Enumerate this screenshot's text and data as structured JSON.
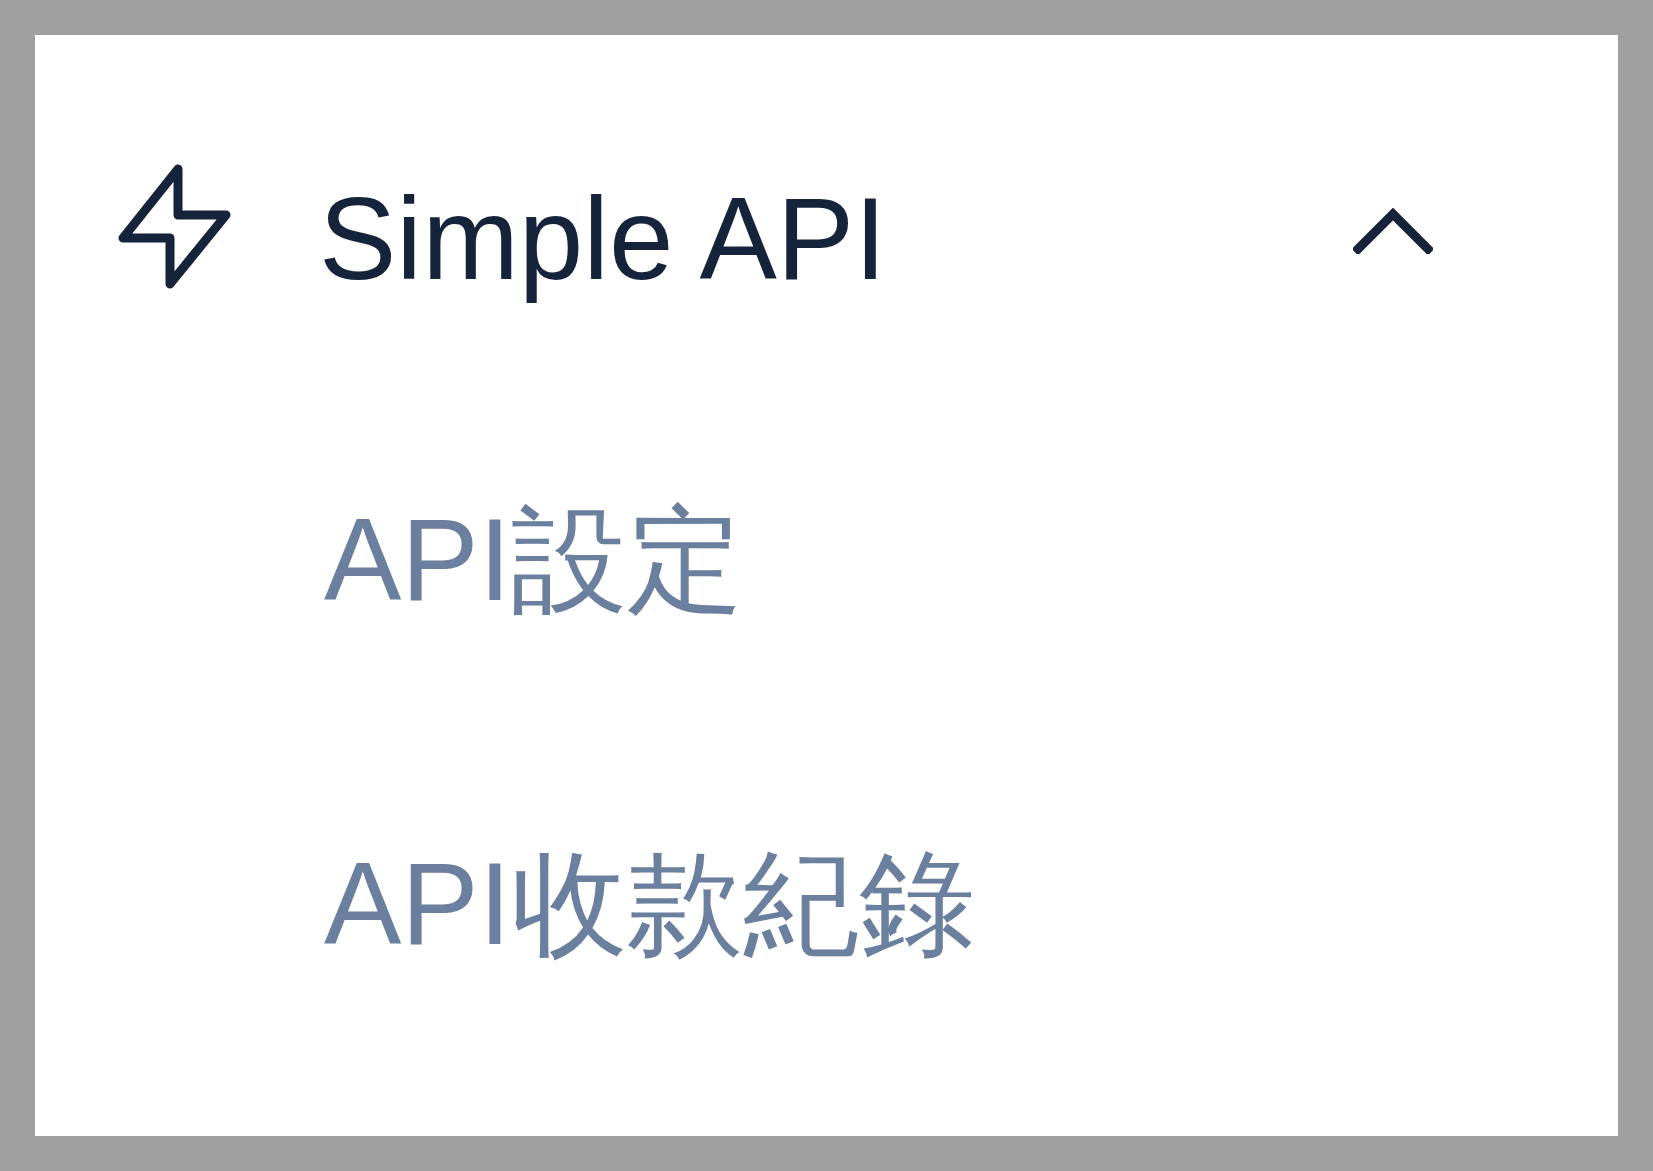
{
  "menu_group": {
    "label": "Simple API",
    "expanded": true,
    "children": [
      {
        "label": "API設定",
        "selected": false
      },
      {
        "label": "API收款紀錄",
        "selected": false
      }
    ]
  }
}
